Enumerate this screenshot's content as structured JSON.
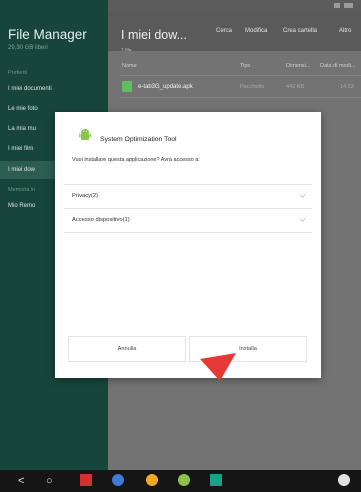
{
  "sidebar": {
    "title": "File Manager",
    "storage": "29,30 GB liberi",
    "favorites_label": "Preferiti",
    "items": [
      "I miei documenti",
      "Le mie foto",
      "La mia mu",
      "I miei film",
      "I miei dow"
    ],
    "memory_label": "Memoria in",
    "memory_items": [
      "Mio Remo"
    ]
  },
  "header": {
    "folder_title": "I miei dow...",
    "file_count": "1 file",
    "actions": [
      "Cerca",
      "Modifica",
      "Crea cartella",
      "Altro"
    ]
  },
  "table": {
    "columns": [
      "Nome",
      "Tipo",
      "Dimensi...",
      "Data di modi..."
    ],
    "rows": [
      {
        "name": "e-tab3G_update.apk",
        "type": "Pacchetto",
        "size": "442 KB",
        "date": "14:53"
      }
    ]
  },
  "dialog": {
    "app_name": "System Optimization Tool",
    "question": "Vuoi installare questa applicazione? Avrà accesso a:",
    "permissions": [
      "Privacy(2)",
      "Accesso dispositivo(1)"
    ],
    "cancel_label": "Annulla",
    "install_label": "Installa"
  },
  "navbar": {
    "back": "<",
    "home": "○",
    "recents": "□"
  },
  "colors": {
    "sidebar_bg": "#17453b",
    "sidebar_active": "#2d5d51",
    "android_green": "#8bc34a",
    "arrow_red": "#e53935"
  },
  "icons": {
    "app_icon": "android-robot-icon",
    "file_icon": "apk-file-icon",
    "chevron": "chevron-down-icon"
  }
}
